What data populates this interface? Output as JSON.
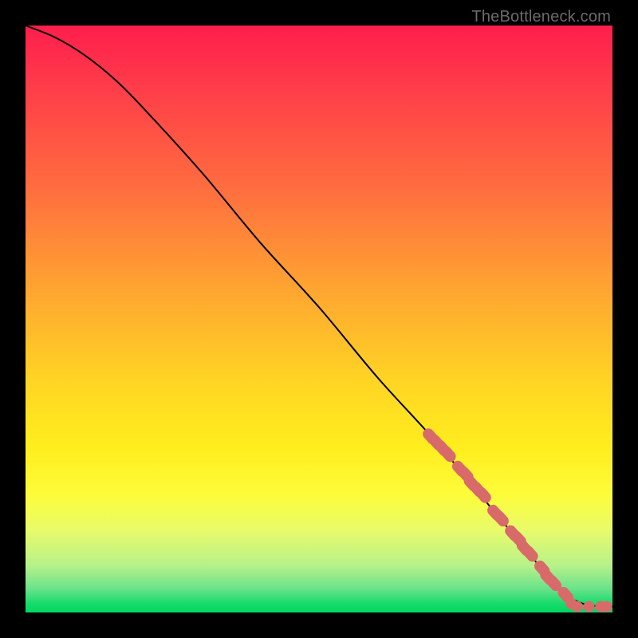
{
  "watermark": "TheBottleneck.com",
  "colors": {
    "dot": "#d86a6a",
    "curve": "#000000"
  },
  "chart_data": {
    "type": "line",
    "title": "",
    "xlabel": "",
    "ylabel": "",
    "xlim": [
      0,
      100
    ],
    "ylim": [
      0,
      100
    ],
    "series": [
      {
        "name": "curve",
        "x": [
          0,
          5,
          10,
          15,
          20,
          30,
          40,
          50,
          60,
          70,
          80,
          85,
          90,
          92,
          95,
          98,
          100
        ],
        "y": [
          100,
          98,
          95,
          91,
          86,
          75,
          63,
          52,
          40,
          29,
          17,
          11,
          5,
          3,
          1.5,
          1,
          1
        ]
      }
    ],
    "scatter": [
      {
        "x": 69,
        "y": 30
      },
      {
        "x": 70,
        "y": 29
      },
      {
        "x": 71,
        "y": 28
      },
      {
        "x": 72,
        "y": 27
      },
      {
        "x": 74,
        "y": 24.5
      },
      {
        "x": 75,
        "y": 23.5
      },
      {
        "x": 76,
        "y": 22
      },
      {
        "x": 77,
        "y": 21
      },
      {
        "x": 78,
        "y": 20
      },
      {
        "x": 80,
        "y": 17
      },
      {
        "x": 81,
        "y": 16
      },
      {
        "x": 83,
        "y": 13.5
      },
      {
        "x": 84,
        "y": 12.5
      },
      {
        "x": 85,
        "y": 11
      },
      {
        "x": 86,
        "y": 10
      },
      {
        "x": 88,
        "y": 7.5
      },
      {
        "x": 89,
        "y": 6
      },
      {
        "x": 90,
        "y": 5
      },
      {
        "x": 92,
        "y": 3
      },
      {
        "x": 93,
        "y": 1.5
      },
      {
        "x": 94,
        "y": 1
      },
      {
        "x": 96,
        "y": 1
      },
      {
        "x": 98,
        "y": 1
      },
      {
        "x": 99,
        "y": 1
      }
    ]
  }
}
